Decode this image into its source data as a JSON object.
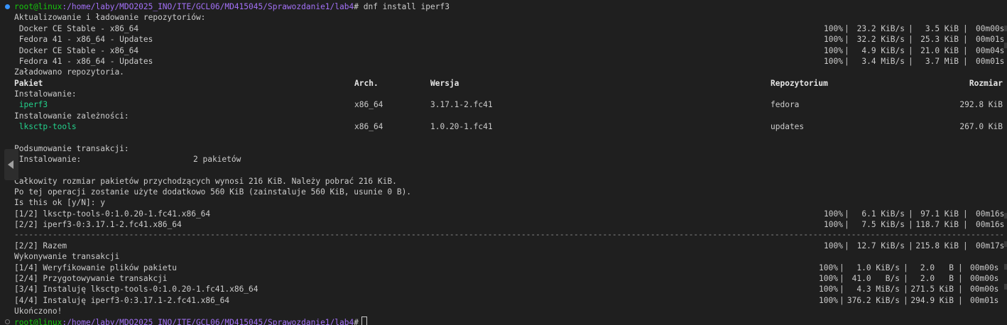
{
  "prompt": {
    "user": "root@linux",
    "path": ":/home/laby/MDO2025_INO/ITE/GCL06/MD415045/Sprawozdanie1/lab4",
    "symbol": "#",
    "command": " dnf install iperf3"
  },
  "refresh_title": "Aktualizowanie i ładowanie repozytoriów:",
  "repos": [
    {
      "name": " Docker CE Stable - x86_64",
      "pct": "100%",
      "speed": "23.2 KiB/s",
      "size": "3.5 KiB",
      "time": "00m00s"
    },
    {
      "name": " Fedora 41 - x86_64 - Updates",
      "pct": "100%",
      "speed": "32.2 KiB/s",
      "size": "25.3 KiB",
      "time": "00m01s"
    },
    {
      "name": " Docker CE Stable - x86_64",
      "pct": "100%",
      "speed": "4.9 KiB/s",
      "size": "21.0 KiB",
      "time": "00m04s"
    },
    {
      "name": " Fedora 41 - x86_64 - Updates",
      "pct": "100%",
      "speed": "3.4 MiB/s",
      "size": "3.7 MiB",
      "time": "00m01s"
    }
  ],
  "repos_loaded": "Załadowano repozytoria.",
  "table": {
    "headers": {
      "package": "Pakiet",
      "arch": "Arch.",
      "version": "Wersja",
      "repo": "Repozytorium",
      "size": "Rozmiar"
    },
    "installing_label": "Instalowanie:",
    "deps_label": "Instalowanie zależności:",
    "rows": [
      {
        "package": " iperf3",
        "arch": "x86_64",
        "version": "3.17.1-2.fc41",
        "repo": "fedora",
        "size": "292.8 KiB"
      },
      {
        "package": " lksctp-tools",
        "arch": "x86_64",
        "version": "1.0.20-1.fc41",
        "repo": "updates",
        "size": "267.0 KiB"
      }
    ]
  },
  "summary": {
    "title": "Podsumowanie transakcji:",
    "install_label": " Instalowanie:",
    "install_count": "2 pakietów",
    "total_size": "Całkowity rozmiar pakietów przychodzących wynosi 216 KiB. Należy pobrać 216 KiB.",
    "after_op": "Po tej operacji zostanie użyte dodatkowo 560 KiB (zainstaluje 560 KiB, usunie 0 B).",
    "confirm": "Is this ok [y/N]: y"
  },
  "downloads": [
    {
      "name": "[1/2] lksctp-tools-0:1.0.20-1.fc41.x86_64",
      "pct": "100%",
      "speed": "6.1 KiB/s",
      "size": "97.1 KiB",
      "time": "00m16s"
    },
    {
      "name": "[2/2] iperf3-0:3.17.1-2.fc41.x86_64",
      "pct": "100%",
      "speed": "7.5 KiB/s",
      "size": "118.7 KiB",
      "time": "00m16s"
    }
  ],
  "separator": "-----------------------------------------------------------------------------------------------------------------------------------------------------------------------------------------------------------------------------------------------------------------------------",
  "total": {
    "name": "[2/2] Razem",
    "pct": "100%",
    "speed": "12.7 KiB/s",
    "size": "215.8 KiB",
    "time": "00m17s"
  },
  "running": "Wykonywanie transakcji",
  "steps": [
    {
      "name": "[1/4] Weryfikowanie plików pakietu",
      "pct": "100%",
      "speed": "1.0 KiB/s",
      "size": "2.0   B",
      "time": "00m00s"
    },
    {
      "name": "[2/4] Przygotowywanie transakcji",
      "pct": "100%",
      "speed": "41.0   B/s",
      "size": "2.0   B",
      "time": "00m00s"
    },
    {
      "name": "[3/4] Instaluję lksctp-tools-0:1.0.20-1.fc41.x86_64",
      "pct": "100%",
      "speed": "4.3 MiB/s",
      "size": "271.5 KiB",
      "time": "00m00s"
    },
    {
      "name": "[4/4] Instaluję iperf3-0:3.17.1-2.fc41.x86_64",
      "pct": "100%",
      "speed": "376.2 KiB/s",
      "size": "294.9 KiB",
      "time": "00m01s"
    }
  ],
  "done": "Ukończono!",
  "colors": {
    "background": "#1f1f1f",
    "text": "#cccccc",
    "prompt_user": "#16c60c",
    "prompt_path": "#a371f7",
    "package": "#23d18b"
  }
}
